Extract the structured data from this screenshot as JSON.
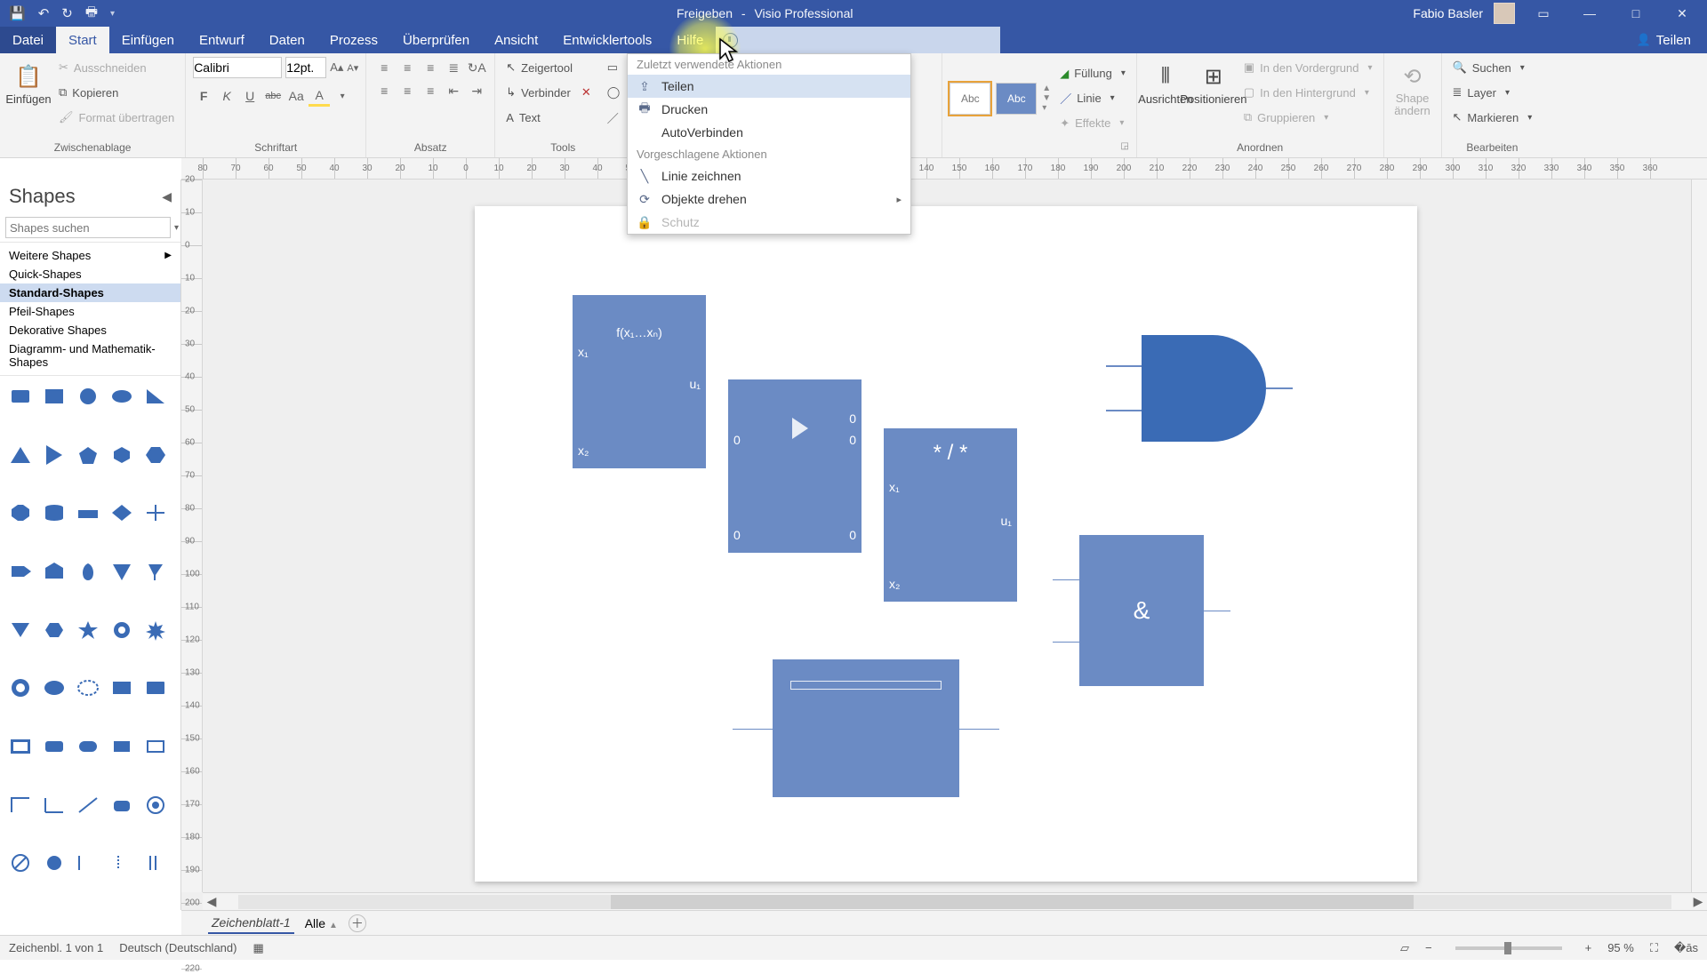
{
  "title": {
    "share_link": "Freigeben",
    "sep": "-",
    "app": "Visio Professional"
  },
  "user": {
    "name": "Fabio Basler"
  },
  "qat": {
    "save": "💾",
    "undo": "↶",
    "redo": "↻",
    "print": "🖶"
  },
  "tabs": {
    "file": "Datei",
    "home": "Start",
    "insert": "Einfügen",
    "design": "Entwurf",
    "data": "Daten",
    "process": "Prozess",
    "review": "Überprüfen",
    "view": "Ansicht",
    "dev": "Entwicklertools",
    "help": "Hilfe"
  },
  "share": "Teilen",
  "ribbon": {
    "clipboard": {
      "paste": "Einfügen",
      "cut": "Ausschneiden",
      "copy": "Kopieren",
      "fmt": "Format übertragen",
      "label": "Zwischenablage"
    },
    "font": {
      "name": "Calibri",
      "size": "12pt.",
      "label": "Schriftart",
      "bold": "F",
      "italic": "K",
      "underline": "U",
      "strike": "abc",
      "case": "Aa",
      "color": "A"
    },
    "para": {
      "label": "Absatz"
    },
    "tools": {
      "pointer": "Zeigertool",
      "connector": "Verbinder",
      "text": "Text",
      "label": "Tools"
    },
    "styles": {
      "abc": "Abc",
      "fill": "Füllung",
      "line": "Linie",
      "effects": "Effekte"
    },
    "arrange": {
      "align": "Ausrichten",
      "position": "Positionieren",
      "front": "In den Vordergrund",
      "back": "In den Hintergrund",
      "group": "Gruppieren",
      "label": "Anordnen",
      "changeshape": "Shape ändern"
    },
    "edit": {
      "find": "Suchen",
      "layer": "Layer",
      "select": "Markieren",
      "label": "Bearbeiten"
    }
  },
  "tellme": {
    "recent_hdr": "Zuletzt verwendete Aktionen",
    "teilen": "Teilen",
    "drucken": "Drucken",
    "autoverb": "AutoVerbinden",
    "suggest_hdr": "Vorgeschlagene Aktionen",
    "linie": "Linie zeichnen",
    "drehen": "Objekte drehen",
    "schutz": "Schutz"
  },
  "shapes": {
    "title": "Shapes",
    "search_ph": "Shapes suchen",
    "cats": {
      "more": "Weitere Shapes",
      "quick": "Quick-Shapes",
      "standard": "Standard-Shapes",
      "arrow": "Pfeil-Shapes",
      "deco": "Dekorative Shapes",
      "diagram": "Diagramm- und Mathematik-Shapes"
    }
  },
  "canvas": {
    "fx": "f(x₁…xₙ)",
    "x1": "x₁",
    "x2": "x₂",
    "u1": "u₁",
    "zero": "0",
    "stars": "*  /  *",
    "amp": "&"
  },
  "sheettabs": {
    "name": "Zeichenblatt-1",
    "all": "Alle"
  },
  "status": {
    "page": "Zeichenbl. 1 von 1",
    "lang": "Deutsch (Deutschland)",
    "zoom": "95 %"
  }
}
